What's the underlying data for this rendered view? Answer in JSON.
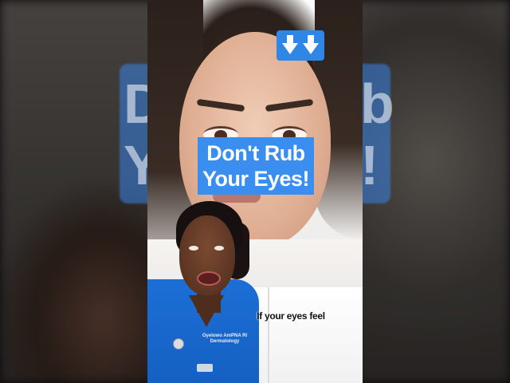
{
  "video": {
    "title_line1": "Don't Rub",
    "title_line2": "Your Eyes!",
    "caption": "If your eyes feel",
    "arrow_badge_icon": "double-down-arrow-icon",
    "name_tag_line1": "Oyelowo AmPNA RI",
    "name_tag_line2": "Dermatology"
  },
  "colors": {
    "title_background": "#3a8ef0",
    "arrow_background": "#2f86e4",
    "scrubs": "#1c6fd6"
  }
}
